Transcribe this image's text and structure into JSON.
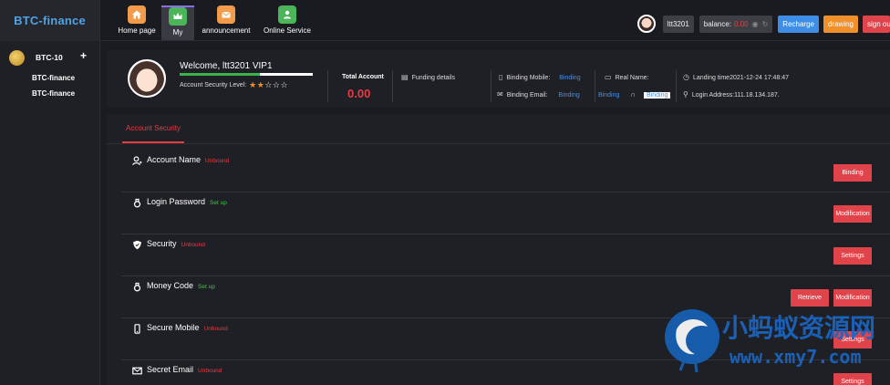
{
  "brand": "BTC-finance",
  "sidebar": {
    "group": "BTC-10",
    "items": [
      "BTC-finance",
      "BTC-finance"
    ]
  },
  "nav": {
    "items": [
      {
        "label": "Home page",
        "icon": "home-icon",
        "color": "#f29b4b"
      },
      {
        "label": "My",
        "icon": "crown-icon",
        "color": "#4cb55a"
      },
      {
        "label": "announcement",
        "icon": "mail-icon",
        "color": "#f29b4b"
      },
      {
        "label": "Online Service",
        "icon": "person-icon",
        "color": "#4cb55a"
      }
    ]
  },
  "topbar": {
    "username": "ltt3201",
    "balance_label": "balance:",
    "balance_value": "0.00",
    "recharge": "Recharge",
    "drawing": "drawing",
    "signout": "sign ou"
  },
  "profile": {
    "welcome": "Welcome, ltt3201 VIP1",
    "security_level_label": "Account Security Level:",
    "security_level_stars": 2,
    "security_progress_fraction": 0.6,
    "total_account_label": "Total Account",
    "total_account_value": "0.00",
    "funding_details": "Funding details",
    "binding_mobile_label": "Binding Mobile:",
    "binding_mobile_value": "Binding",
    "binding_email_label": "Binding Email:",
    "binding_email_value": "Binding",
    "real_name_label": "Real Name:",
    "real_name_binding_link": "Binding",
    "real_name_binding_button": "Binding",
    "landing_time": "Landing time2021-12-24 17:48:47",
    "login_address": "Login Address:111.18.134.187."
  },
  "security": {
    "tab": "Account Security",
    "rows": [
      {
        "name": "Account Name",
        "status": "Unbound",
        "status_color": "#e53b45",
        "icon": "user-icon",
        "buttons": [
          "Binding"
        ]
      },
      {
        "name": "Login Password",
        "status": "Set up",
        "status_color": "#48c24a",
        "icon": "lock-icon",
        "buttons": [
          "Modification"
        ]
      },
      {
        "name": "Security",
        "status": "Unbound",
        "status_color": "#e53b45",
        "icon": "shield-icon",
        "buttons": [
          "Settings"
        ]
      },
      {
        "name": "Money Code",
        "status": "Set up",
        "status_color": "#48c24a",
        "icon": "lock-icon",
        "buttons": [
          "Retrieve",
          "Modification"
        ]
      },
      {
        "name": "Secure Mobile",
        "status": "Unbound",
        "status_color": "#e53b45",
        "icon": "phone-icon",
        "buttons": [
          "Settings"
        ]
      },
      {
        "name": "Secret Email",
        "status": "Unbound",
        "status_color": "#e53b45",
        "icon": "mail-icon",
        "buttons": [
          "Settings"
        ]
      }
    ]
  },
  "watermark": {
    "cn": "小蚂蚁资源网",
    "url": "www.xmy7.com"
  }
}
